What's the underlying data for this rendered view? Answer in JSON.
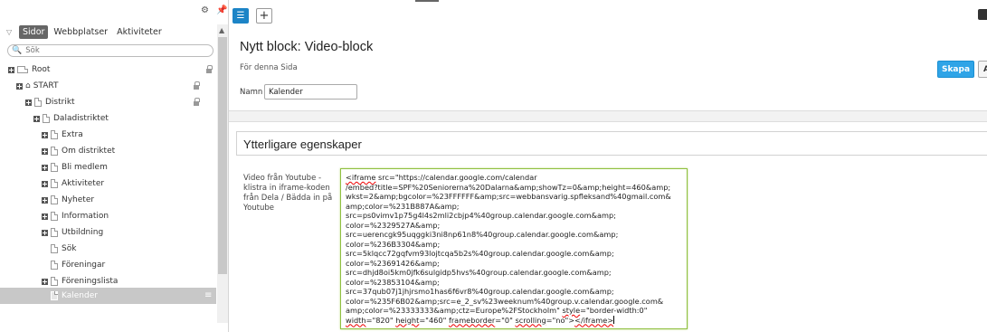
{
  "tree": {
    "tabs": [
      "Sidor",
      "Webbplatser",
      "Aktiviteter"
    ],
    "search_placeholder": "Sök",
    "nodes": [
      {
        "label": "Root"
      },
      {
        "label": "START"
      },
      {
        "label": "Distrikt"
      },
      {
        "label": "Daladistriktet"
      },
      {
        "label": "Extra"
      },
      {
        "label": "Om distriktet"
      },
      {
        "label": "Bli medlem"
      },
      {
        "label": "Aktiviteter"
      },
      {
        "label": "Nyheter"
      },
      {
        "label": "Information"
      },
      {
        "label": "Utbildning"
      },
      {
        "label": "Sök"
      },
      {
        "label": "Föreningar"
      },
      {
        "label": "Föreningslista"
      },
      {
        "label": "Kalender"
      }
    ]
  },
  "form": {
    "title": "Nytt block: Video-block",
    "subtitle": "För denna Sida",
    "create_label": "Skapa",
    "cancel_label": "Avbryt",
    "name_label": "Namn",
    "name_value": "Kalender",
    "section_title": "Ytterligare egenskaper",
    "field_label": "Video från Youtube - klistra in iframe-koden från Dela / Bädda in på Youtube",
    "field_lines": [
      "src=\"https://calendar.google.com/calendar",
      "/embed?title=SPF%20Seniorerna%20Dalarna&amp;showTz=0&amp;height=460&amp;",
      "wkst=2&amp;bgcolor=%23FFFFFF&amp;src=webbansvarig.spfleksand%40gmail.com&",
      "amp;color=%231B887A&amp;",
      "src=ps0vimv1p75g4l4s2mli2cbjp4%40group.calendar.google.com&amp;",
      "color=%2329527A&amp;",
      "src=uerencgk95uqggki3ni8np61n8%40group.calendar.google.com&amp;",
      "color=%236B3304&amp;",
      "src=5klqcc72gqfvm93lojtcqa5b2s%40group.calendar.google.com&amp;",
      "color=%23691426&amp;",
      "src=dhjd8oi5km0jfk6sulgidp5hvs%40group.calendar.google.com&amp;",
      "color=%23853104&amp;",
      "src=37qub07j1jhjrsmo1has6f6vr8%40group.calendar.google.com&amp;",
      "color=%235F6B02&amp;src=e_2_sv%23weeknum%40group.v.calendar.google.com&",
      "amp;color=%23333333&amp;ctz=Europe%2FStockholm\""
    ],
    "field_tag_open": "<iframe",
    "field_style_attr": "style",
    "field_style_value": "=\"border-width:0\"",
    "field_width_attr": "width",
    "field_width_value": "=\"820\" ",
    "field_height_attr": "height",
    "field_height_value": "=\"460\" ",
    "field_frameborder_attr": "frameborder",
    "field_frameborder_value": "=\"0\" ",
    "field_scrolling_attr": "scrolling",
    "field_scrolling_value": "=\"no\">",
    "field_tag_close": "</iframe>"
  }
}
